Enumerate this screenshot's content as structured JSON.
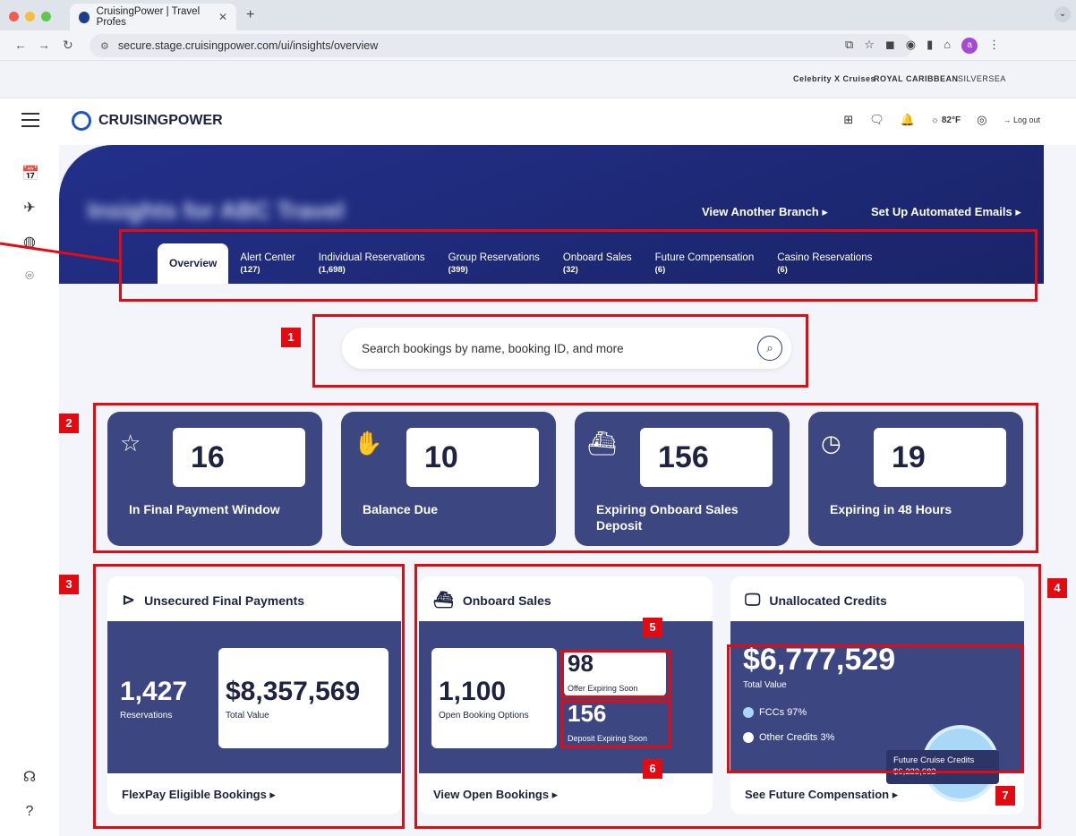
{
  "browser": {
    "tab_title": "CruisingPower | Travel Profes",
    "url": "secure.stage.cruisingpower.com/ui/insights/overview",
    "profile_initial": "a"
  },
  "brands": {
    "celebrity": "Celebrity X Cruises",
    "royal": "ROYAL CARIBBEAN",
    "silversea": "SILVERSEA"
  },
  "header": {
    "logo": "CRUISINGPOWER",
    "weather": "82°F",
    "logout": "Log out"
  },
  "banner": {
    "title": "Insights for ABC Travel",
    "view_branch": "View Another Branch ▸",
    "automated": "Set Up Automated Emails ▸"
  },
  "tabs": [
    {
      "label": "Overview",
      "count": ""
    },
    {
      "label": "Alert Center",
      "count": "(127)"
    },
    {
      "label": "Individual Reservations",
      "count": "(1,698)"
    },
    {
      "label": "Group Reservations",
      "count": "(399)"
    },
    {
      "label": "Onboard Sales",
      "count": "(32)"
    },
    {
      "label": "Future Compensation",
      "count": "(6)"
    },
    {
      "label": "Casino Reservations",
      "count": "(6)"
    }
  ],
  "search": {
    "placeholder": "Search bookings by name, booking ID, and more"
  },
  "stats": [
    {
      "value": "16",
      "label": "In Final Payment Window",
      "icon": "calendar-star-icon"
    },
    {
      "value": "10",
      "label": "Balance Due",
      "icon": "hand-coins-icon"
    },
    {
      "value": "156",
      "label": "Expiring Onboard Sales Deposit",
      "icon": "ship-clock-icon"
    },
    {
      "value": "19",
      "label": "Expiring in 48 Hours",
      "icon": "clock-icon"
    }
  ],
  "unsecured": {
    "title": "Unsecured Final Payments",
    "reservations": "1,427",
    "reservations_label": "Reservations",
    "total": "$8,357,569",
    "total_label": "Total Value",
    "link": "FlexPay Eligible Bookings ▸"
  },
  "onboard": {
    "title": "Onboard Sales",
    "open": "1,100",
    "open_label": "Open Booking Options",
    "offer": "98",
    "offer_label": "Offer Expiring Soon",
    "deposit": "156",
    "deposit_label": "Deposit Expiring Soon",
    "link": "View Open Bookings ▸"
  },
  "credits": {
    "title": "Unallocated Credits",
    "total": "$6,777,529",
    "total_label": "Total Value",
    "fcc": "FCCs 97%",
    "other": "Other Credits 3%",
    "tip_title": "Future Cruise Credits",
    "tip_value": "$6,223,682",
    "link": "See Future Compensation ▸"
  },
  "callouts": [
    "1",
    "2",
    "3",
    "4",
    "5",
    "6",
    "7"
  ],
  "colors": {
    "navy": "#1a2468",
    "card": "#3c4680",
    "callout": "#e30b12"
  }
}
